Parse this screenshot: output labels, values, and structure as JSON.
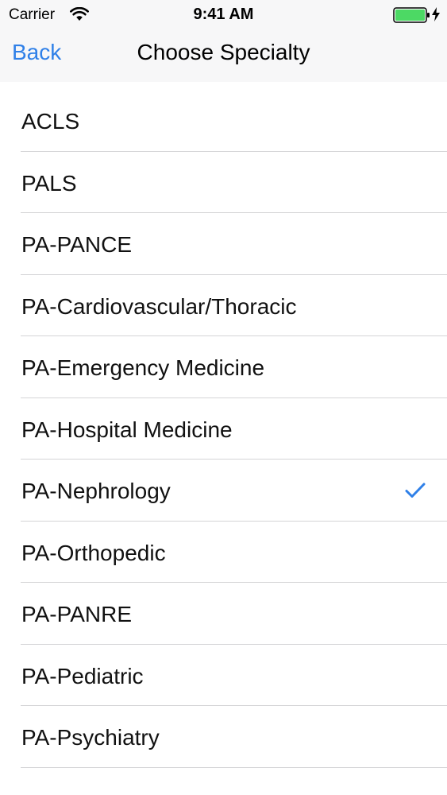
{
  "status_bar": {
    "carrier": "Carrier",
    "time": "9:41 AM",
    "wifi_icon": "wifi-icon",
    "battery_icon": "battery-icon",
    "charging_icon": "charging-bolt-icon",
    "battery_color": "#4cd964"
  },
  "nav": {
    "back_label": "Back",
    "title": "Choose Specialty",
    "accent_color": "#2f80e8"
  },
  "list": {
    "items": [
      {
        "label": "ACLS",
        "selected": false
      },
      {
        "label": "PALS",
        "selected": false
      },
      {
        "label": "PA-PANCE",
        "selected": false
      },
      {
        "label": "PA-Cardiovascular/Thoracic",
        "selected": false
      },
      {
        "label": "PA-Emergency Medicine",
        "selected": false
      },
      {
        "label": "PA-Hospital Medicine",
        "selected": false
      },
      {
        "label": "PA-Nephrology",
        "selected": true
      },
      {
        "label": "PA-Orthopedic",
        "selected": false
      },
      {
        "label": "PA-PANRE",
        "selected": false
      },
      {
        "label": "PA-Pediatric",
        "selected": false
      },
      {
        "label": "PA-Psychiatry",
        "selected": false
      }
    ],
    "check_icon": "checkmark-icon"
  }
}
